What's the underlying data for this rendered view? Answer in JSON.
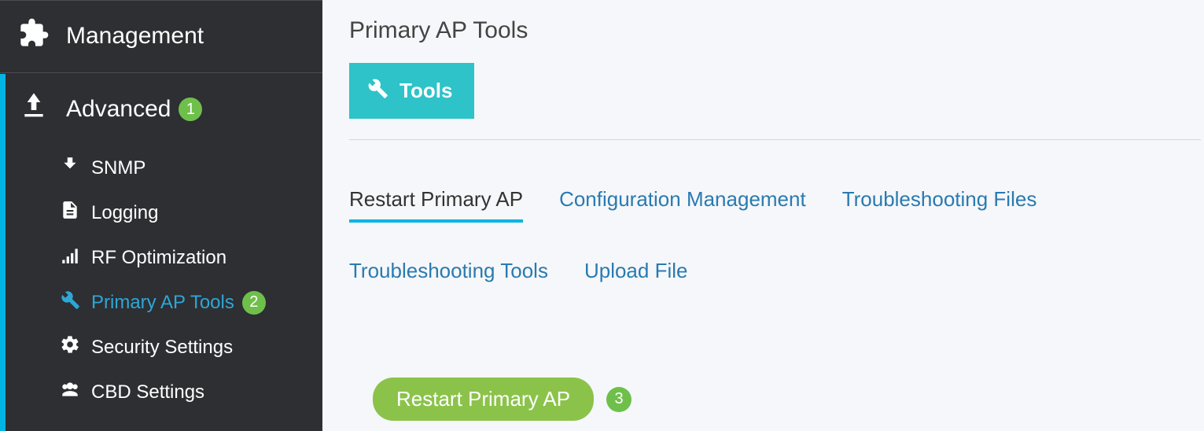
{
  "sidebar": {
    "management_label": "Management",
    "advanced_label": "Advanced",
    "advanced_badge": "1",
    "sub": {
      "snmp": "SNMP",
      "logging": "Logging",
      "rf": "RF Optimization",
      "pat": "Primary AP Tools",
      "pat_badge": "2",
      "security": "Security Settings",
      "cbd": "CBD Settings"
    }
  },
  "main": {
    "title": "Primary AP Tools",
    "tools_label": "Tools",
    "subtabs": {
      "restart": "Restart Primary AP",
      "config": "Configuration Management",
      "files": "Troubleshooting Files",
      "ttools": "Troubleshooting Tools",
      "upload": "Upload File"
    },
    "restart_button": "Restart Primary AP",
    "restart_badge": "3"
  }
}
